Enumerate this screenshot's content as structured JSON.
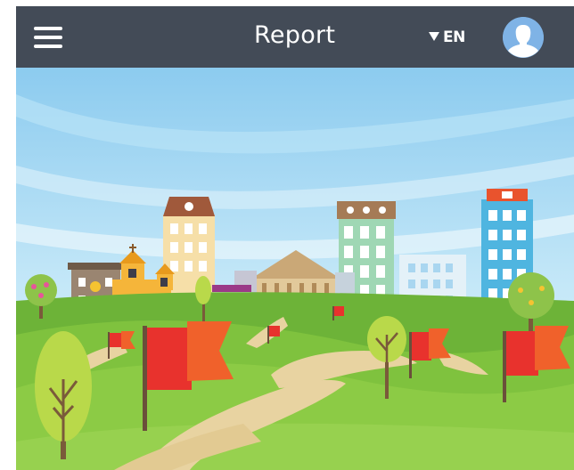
{
  "header": {
    "title": "Report",
    "language": "EN",
    "menu_icon": "hamburger-menu-icon",
    "avatar_icon": "user-avatar-icon",
    "language_caret_icon": "caret-down-icon"
  },
  "hero": {
    "illustration": "town-landscape-with-red-flags"
  },
  "colors": {
    "header_bg": "#434b57",
    "sky": "#b6e0f5",
    "grass": "#7fbf3a",
    "flag": "#e8322d",
    "path": "#e6cf9c"
  }
}
